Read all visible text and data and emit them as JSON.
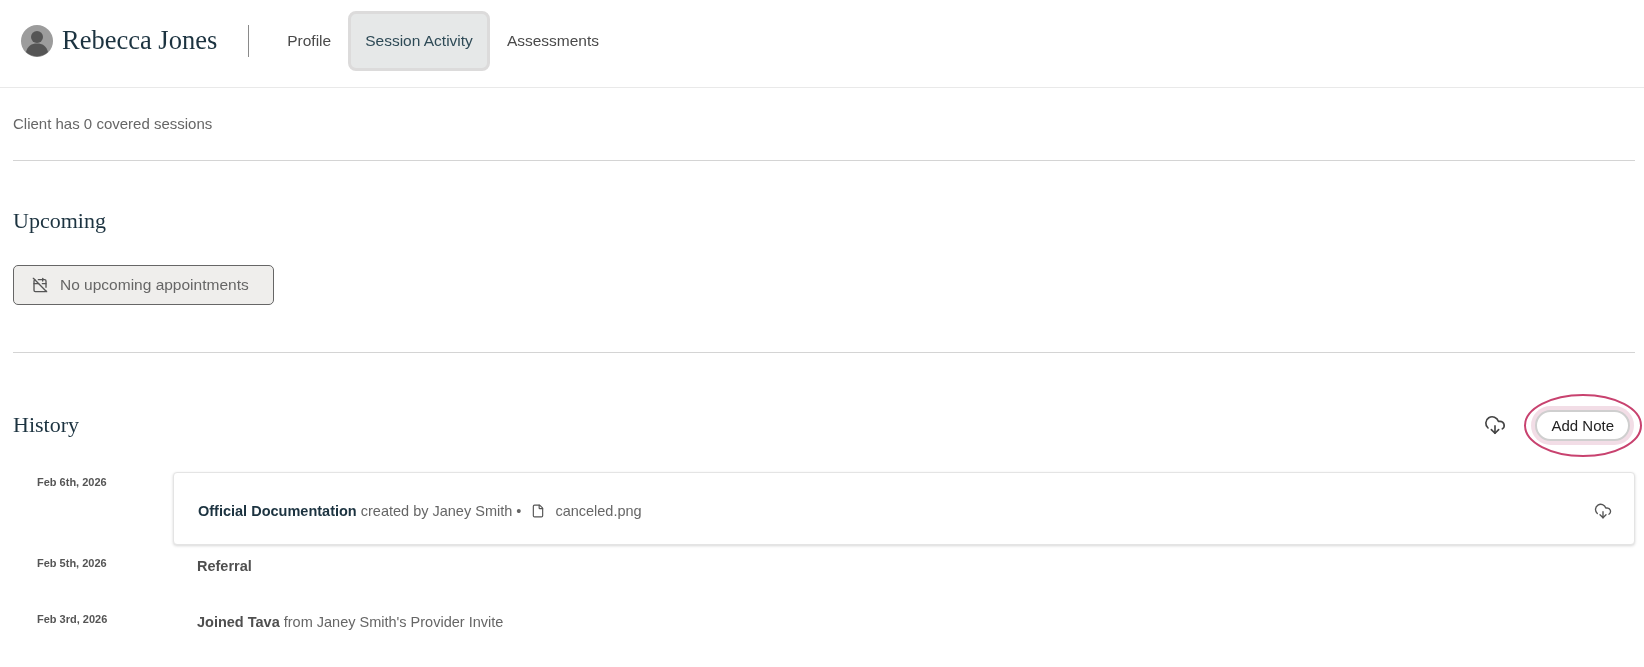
{
  "header": {
    "client_name": "Rebecca Jones",
    "tabs": [
      {
        "label": "Profile",
        "selected": false
      },
      {
        "label": "Session Activity",
        "selected": true
      },
      {
        "label": "Assessments",
        "selected": false
      }
    ]
  },
  "coverage_note": "Client has 0 covered sessions",
  "upcoming": {
    "title": "Upcoming",
    "empty_message": "No upcoming appointments"
  },
  "history": {
    "title": "History",
    "add_note": {
      "label": "Add Note",
      "highlighted": true
    },
    "entries": [
      {
        "date": "Feb 6th, 2026",
        "kind": "document",
        "title": "Official Documentation",
        "detail": "created by Janey Smith •",
        "attachment": "canceled.png"
      },
      {
        "date": "Feb 5th, 2026",
        "kind": "event",
        "title": "Referral"
      },
      {
        "date": "Feb 3rd, 2026",
        "kind": "event",
        "title": "Joined Tava",
        "detail": "from Janey Smith's Provider Invite"
      }
    ]
  }
}
